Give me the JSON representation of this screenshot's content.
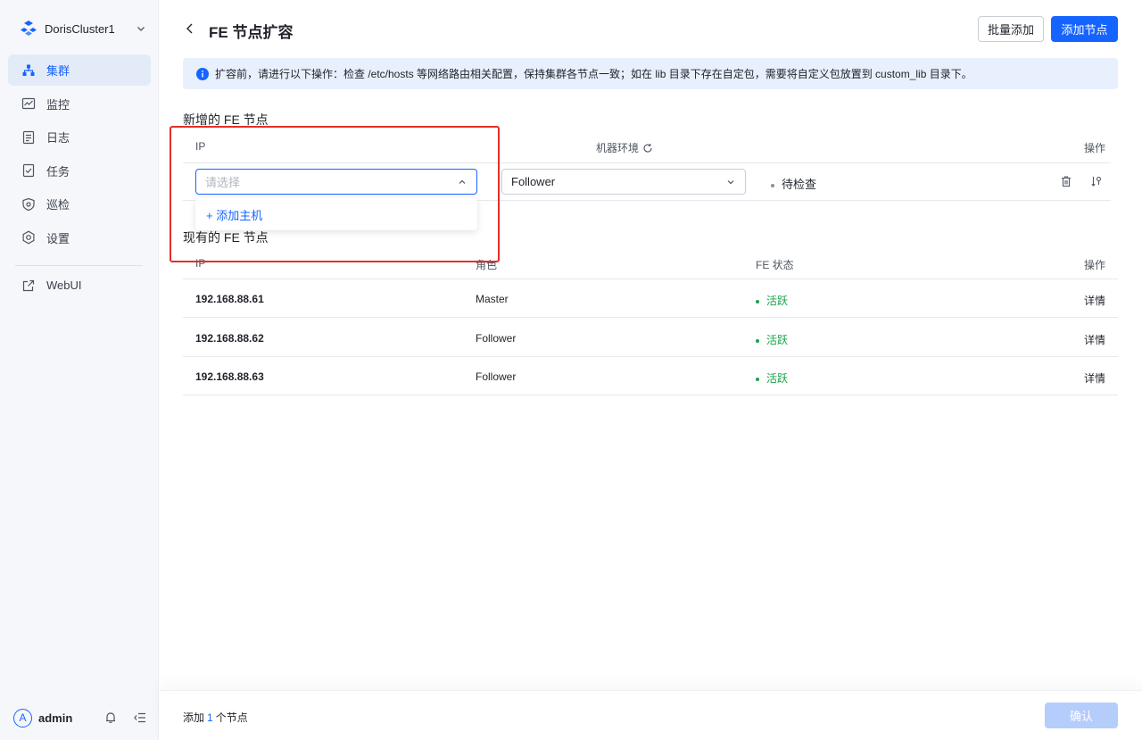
{
  "cluster": {
    "name": "DorisCluster1"
  },
  "nav": {
    "items": [
      {
        "label": "集群",
        "icon": "cluster-icon",
        "active": true
      },
      {
        "label": "监控",
        "icon": "monitor-icon"
      },
      {
        "label": "日志",
        "icon": "log-icon"
      },
      {
        "label": "任务",
        "icon": "task-icon"
      },
      {
        "label": "巡检",
        "icon": "inspect-icon"
      },
      {
        "label": "设置",
        "icon": "settings-icon"
      }
    ],
    "webui": "WebUI"
  },
  "user": {
    "avatar_letter": "A",
    "name": "admin"
  },
  "header": {
    "title": "FE 节点扩容",
    "batch_add": "批量添加",
    "add_node": "添加节点"
  },
  "alert": {
    "text": "扩容前，请进行以下操作：检查 /etc/hosts 等网络路由相关配置，保持集群各节点一致；如在 lib 目录下存在自定包，需要将自定义包放置到 custom_lib 目录下。"
  },
  "new_nodes": {
    "title": "新增的 FE 节点",
    "headers": {
      "ip": "IP",
      "env": "机器环境",
      "action": "操作"
    },
    "row": {
      "ip_placeholder": "请选择",
      "role": "Follower",
      "status": "待检查"
    },
    "dropdown": {
      "add_host": "+ 添加主机"
    }
  },
  "existing_nodes": {
    "title": "现有的 FE 节点",
    "headers": {
      "ip": "IP",
      "role": "角色",
      "status": "FE 状态",
      "action": "操作"
    },
    "rows": [
      {
        "ip": "192.168.88.61",
        "role": "Master",
        "status": "活跃",
        "action": "详情"
      },
      {
        "ip": "192.168.88.62",
        "role": "Follower",
        "status": "活跃",
        "action": "详情"
      },
      {
        "ip": "192.168.88.63",
        "role": "Follower",
        "status": "活跃",
        "action": "详情"
      }
    ]
  },
  "footer": {
    "prefix": "添加",
    "count": "1",
    "suffix": "个节点",
    "confirm": "确认"
  },
  "colors": {
    "primary": "#1664ff",
    "active_green": "#1aa34a",
    "highlight_red": "#e0302a"
  }
}
